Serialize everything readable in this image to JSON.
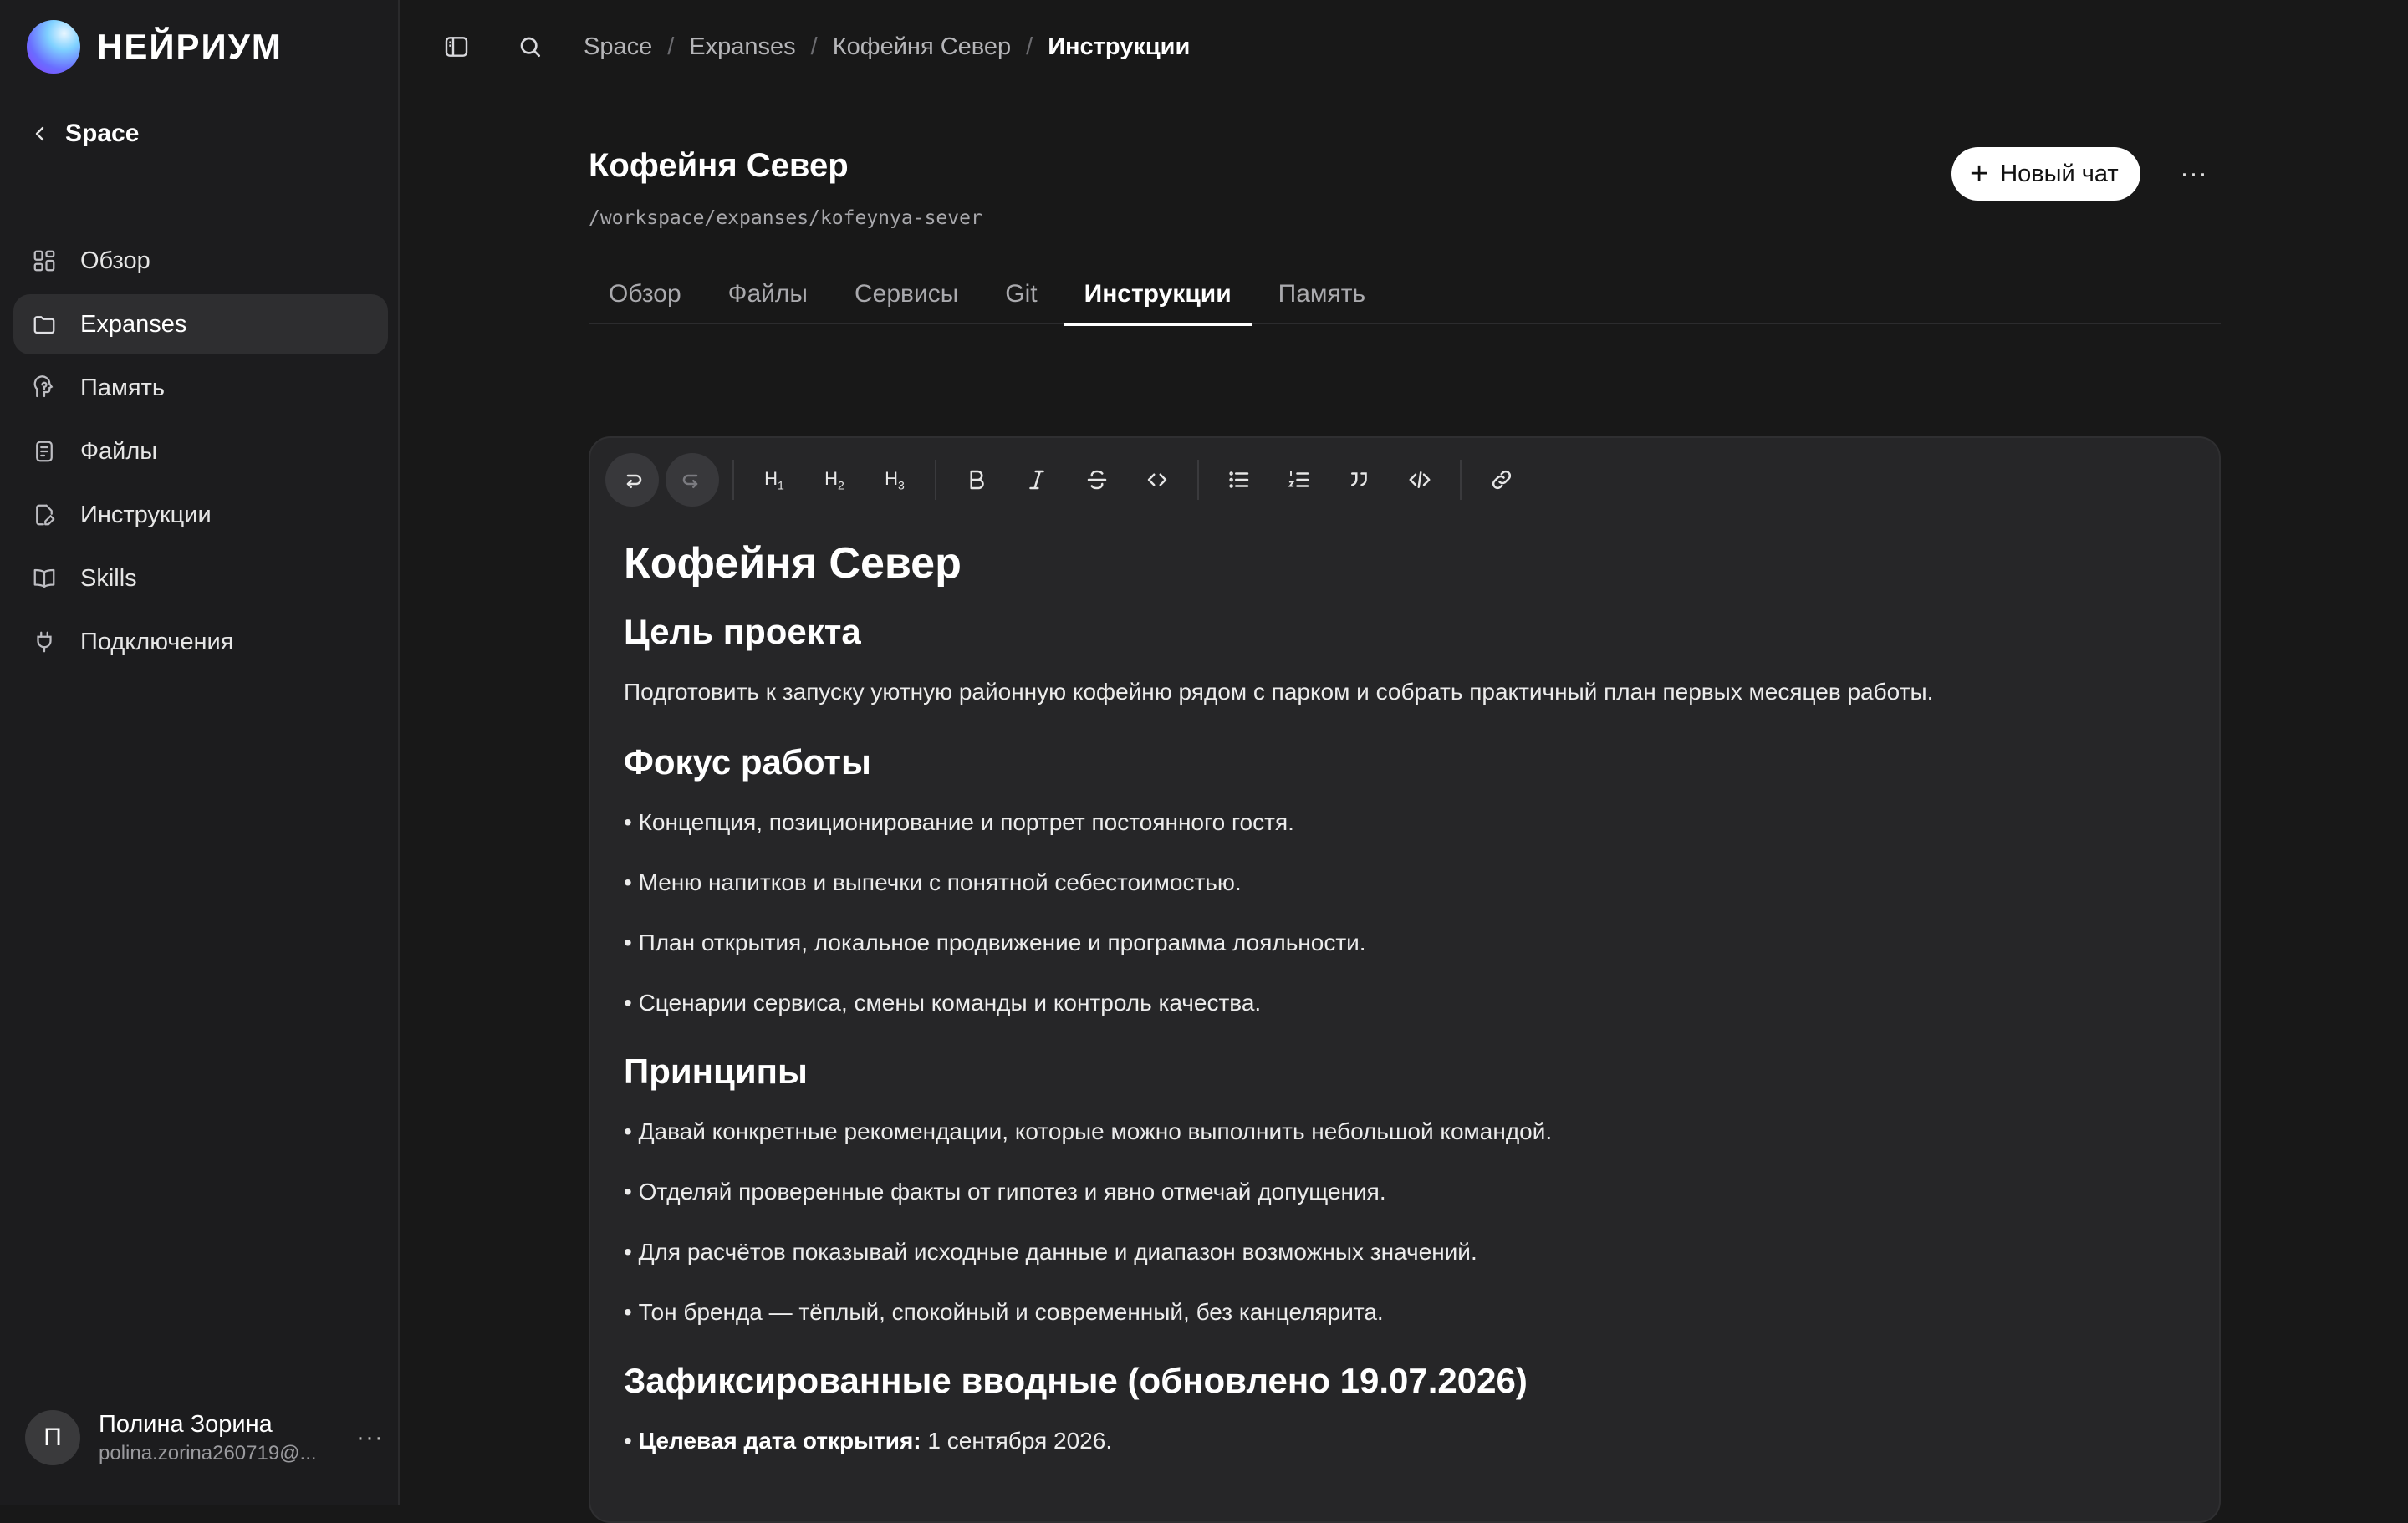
{
  "brand": {
    "name": "НЕЙРИУМ"
  },
  "sidebar": {
    "back_label": "Space",
    "items": [
      {
        "label": "Обзор",
        "icon": "grid-icon"
      },
      {
        "label": "Expanses",
        "icon": "folder-icon",
        "active": true
      },
      {
        "label": "Память",
        "icon": "brain-icon"
      },
      {
        "label": "Файлы",
        "icon": "file-icon"
      },
      {
        "label": "Инструкции",
        "icon": "file-edit-icon"
      },
      {
        "label": "Skills",
        "icon": "book-icon"
      },
      {
        "label": "Подключения",
        "icon": "plug-icon"
      }
    ],
    "user": {
      "initial": "П",
      "name": "Полина Зорина",
      "email": "polina.zorina260719@..."
    }
  },
  "breadcrumb": [
    "Space",
    "Expanses",
    "Кофейня Север",
    "Инструкции"
  ],
  "header": {
    "title": "Кофейня Север",
    "path": "/workspace/expanses/kofeynya-sever",
    "new_chat_label": "Новый чат",
    "more_label": "···"
  },
  "tabs": [
    "Обзор",
    "Файлы",
    "Сервисы",
    "Git",
    "Инструкции",
    "Память"
  ],
  "active_tab": "Инструкции",
  "editor": {
    "toolbar": [
      "undo",
      "redo",
      "H1",
      "H2",
      "H3",
      "bold",
      "italic",
      "strikethrough",
      "code",
      "bullet-list",
      "ordered-list",
      "quote",
      "code-block",
      "link"
    ],
    "title": "Кофейня Север",
    "section_goal": {
      "heading": "Цель проекта",
      "text": "Подготовить к запуску уютную районную кофейню рядом с парком и собрать практичный план первых месяцев работы."
    },
    "section_focus": {
      "heading": "Фокус работы",
      "items": [
        "• Концепция, позиционирование и портрет постоянного гостя.",
        "• Меню напитков и выпечки с понятной себестоимостью.",
        "• План открытия, локальное продвижение и программа лояльности.",
        "• Сценарии сервиса, смены команды и контроль качества."
      ]
    },
    "section_principles": {
      "heading": "Принципы",
      "items": [
        "• Давай конкретные рекомендации, которые можно выполнить небольшой командой.",
        "• Отделяй проверенные факты от гипотез и явно отмечай допущения.",
        "• Для расчётов показывай исходные данные и диапазон возможных значений.",
        "• Тон бренда — тёплый, спокойный и современный, без канцелярита."
      ]
    },
    "section_inputs": {
      "heading": "Зафиксированные вводные (обновлено 19.07.2026)",
      "item_bullet": "• ",
      "item_label": "Целевая дата открытия:",
      "item_value": " 1 сентября 2026."
    }
  }
}
